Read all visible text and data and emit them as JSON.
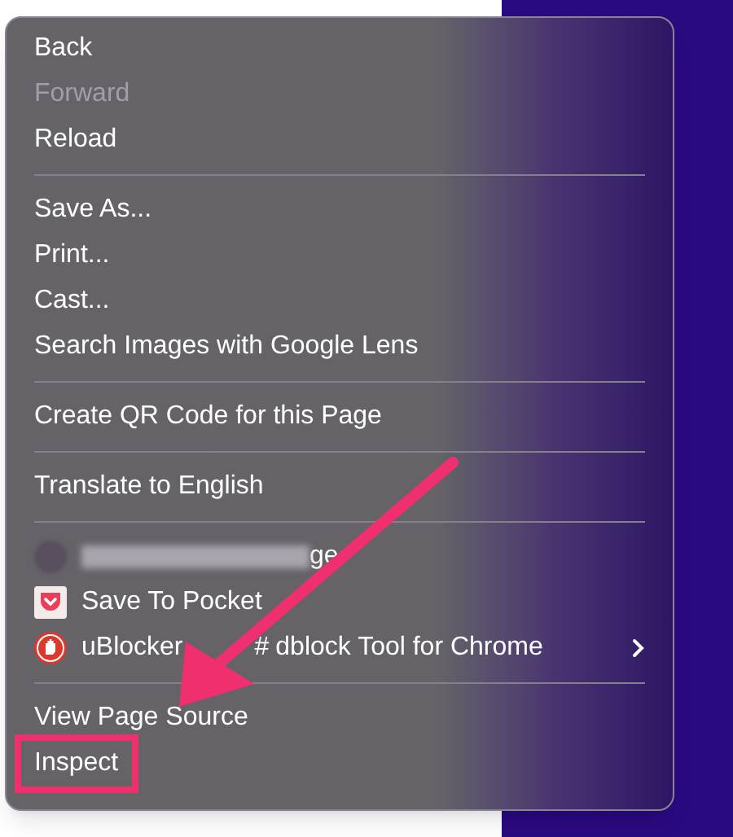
{
  "menu": {
    "items": [
      {
        "kind": "item",
        "label": "Back",
        "disabled": false
      },
      {
        "kind": "item",
        "label": "Forward",
        "disabled": true
      },
      {
        "kind": "item",
        "label": "Reload",
        "disabled": false
      },
      {
        "kind": "separator"
      },
      {
        "kind": "item",
        "label": "Save As...",
        "disabled": false
      },
      {
        "kind": "item",
        "label": "Print...",
        "disabled": false
      },
      {
        "kind": "item",
        "label": "Cast...",
        "disabled": false
      },
      {
        "kind": "item",
        "label": "Search Images with Google Lens",
        "disabled": false
      },
      {
        "kind": "separator"
      },
      {
        "kind": "item",
        "label": "Create QR Code for this Page",
        "disabled": false
      },
      {
        "kind": "separator"
      },
      {
        "kind": "item",
        "label": "Translate to English",
        "disabled": false
      },
      {
        "kind": "separator"
      },
      {
        "kind": "extension",
        "blurred": true,
        "label_parts": [
          "ge"
        ],
        "submenu": false
      },
      {
        "kind": "extension",
        "blurred": false,
        "label_parts": [
          "Save To Pocket"
        ],
        "submenu": false
      },
      {
        "kind": "extension",
        "blurred": false,
        "label_parts": [
          "uBlocker",
          "#",
          "dblock Tool for Chrome"
        ],
        "submenu": true
      },
      {
        "kind": "separator"
      },
      {
        "kind": "item",
        "label": "View Page Source",
        "disabled": false
      },
      {
        "kind": "item",
        "label": "Inspect",
        "disabled": false,
        "highlighted": true
      }
    ]
  }
}
